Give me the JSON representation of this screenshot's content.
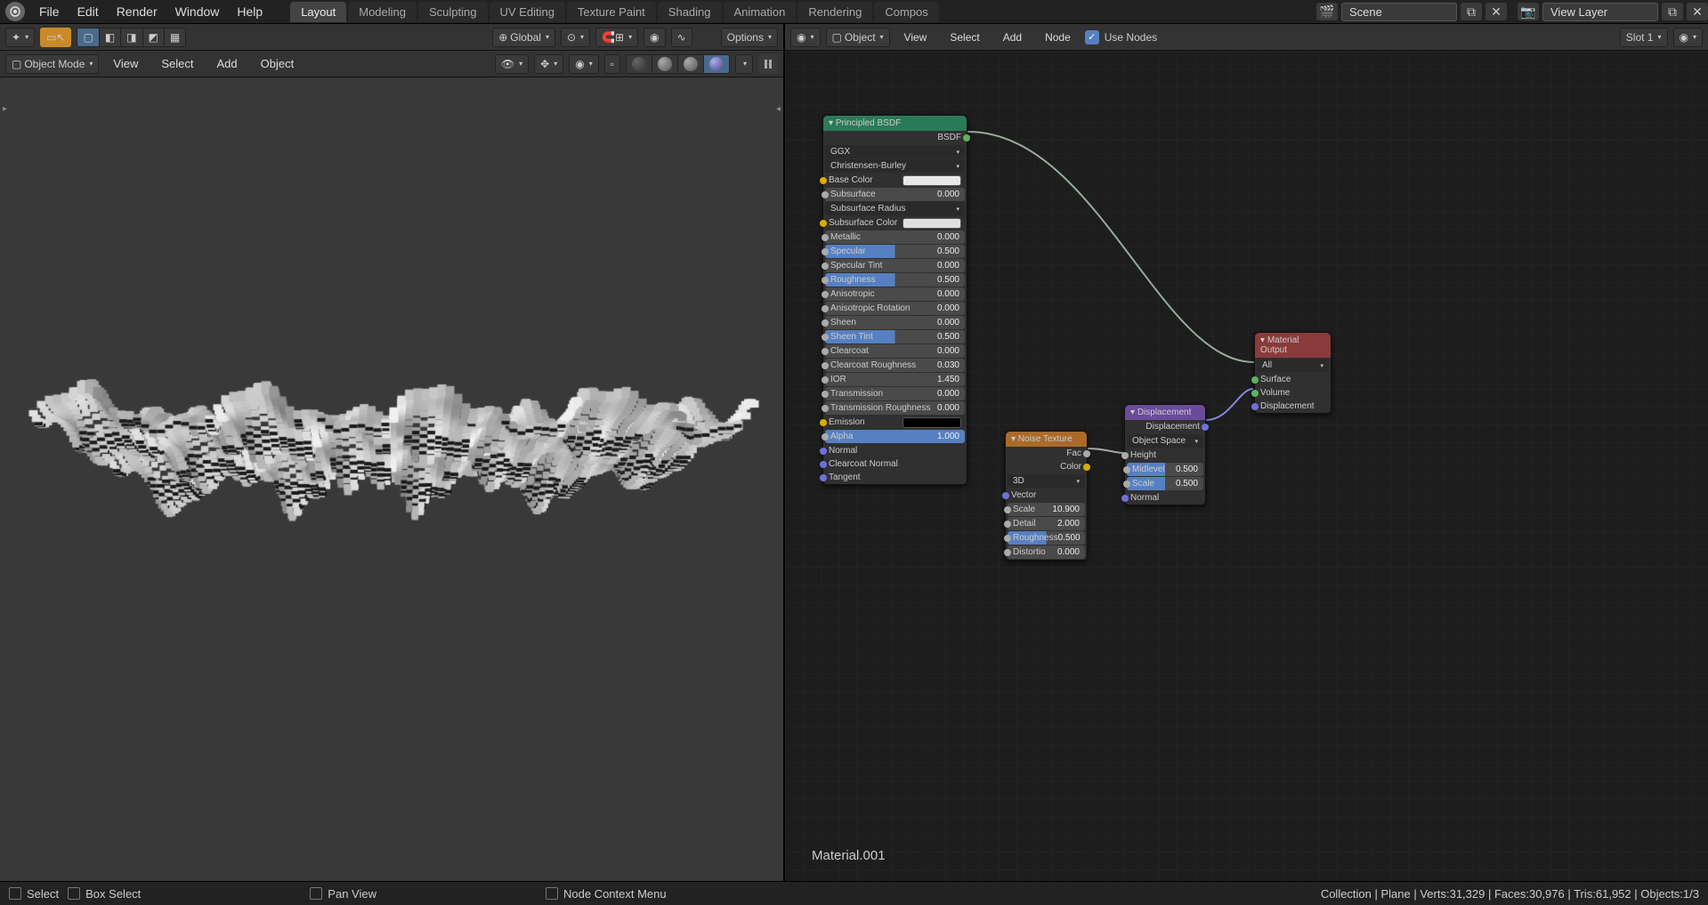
{
  "menu": {
    "items": [
      "File",
      "Edit",
      "Render",
      "Window",
      "Help"
    ]
  },
  "workspaces": {
    "items": [
      "Layout",
      "Modeling",
      "Sculpting",
      "UV Editing",
      "Texture Paint",
      "Shading",
      "Animation",
      "Rendering",
      "Compos"
    ],
    "active": 0
  },
  "scene": {
    "label": "Scene",
    "viewlayer": "View Layer"
  },
  "viewport": {
    "orientation": "Global",
    "mode": "Object Mode",
    "menus": [
      "View",
      "Select",
      "Add",
      "Object"
    ],
    "options": "Options"
  },
  "node_editor": {
    "mode": "Object",
    "menus": [
      "View",
      "Select",
      "Add",
      "Node"
    ],
    "use_nodes": "Use Nodes",
    "slot": "Slot 1",
    "material": "Material.001"
  },
  "nodes": {
    "bsdf": {
      "title": "Principled BSDF",
      "output": "BSDF",
      "distribution": "GGX",
      "sss_method": "Christensen-Burley",
      "props": [
        {
          "name": "Base Color",
          "type": "color",
          "value": "#e8e8e8"
        },
        {
          "name": "Subsurface",
          "type": "slider",
          "value": "0.000"
        },
        {
          "name": "Subsurface Radius",
          "type": "dropdown"
        },
        {
          "name": "Subsurface Color",
          "type": "color",
          "value": "#e0e0e0"
        },
        {
          "name": "Metallic",
          "type": "slider",
          "value": "0.000"
        },
        {
          "name": "Specular",
          "type": "sliderfill",
          "value": "0.500"
        },
        {
          "name": "Specular Tint",
          "type": "slider",
          "value": "0.000"
        },
        {
          "name": "Roughness",
          "type": "sliderfill",
          "value": "0.500"
        },
        {
          "name": "Anisotropic",
          "type": "slider",
          "value": "0.000"
        },
        {
          "name": "Anisotropic Rotation",
          "type": "slider",
          "value": "0.000"
        },
        {
          "name": "Sheen",
          "type": "slider",
          "value": "0.000"
        },
        {
          "name": "Sheen Tint",
          "type": "sliderfill",
          "value": "0.500"
        },
        {
          "name": "Clearcoat",
          "type": "slider",
          "value": "0.000"
        },
        {
          "name": "Clearcoat Roughness",
          "type": "slider",
          "value": "0.030"
        },
        {
          "name": "IOR",
          "type": "slider",
          "value": "1.450"
        },
        {
          "name": "Transmission",
          "type": "slider",
          "value": "0.000"
        },
        {
          "name": "Transmission Roughness",
          "type": "slider",
          "value": "0.000"
        },
        {
          "name": "Emission",
          "type": "color",
          "value": "#000000"
        },
        {
          "name": "Alpha",
          "type": "sliderfull",
          "value": "1.000"
        },
        {
          "name": "Normal",
          "type": "input"
        },
        {
          "name": "Clearcoat Normal",
          "type": "input"
        },
        {
          "name": "Tangent",
          "type": "input"
        }
      ]
    },
    "noise": {
      "title": "Noise Texture",
      "outputs": [
        "Fac",
        "Color"
      ],
      "dim": "3D",
      "vector": "Vector",
      "props": [
        {
          "name": "Scale",
          "value": "10.900"
        },
        {
          "name": "Detail",
          "value": "2.000"
        },
        {
          "name": "Roughness",
          "value": "0.500",
          "fill": true
        },
        {
          "name": "Distortio",
          "value": "0.000"
        }
      ]
    },
    "displacement": {
      "title": "Displacement",
      "output": "Displacement",
      "space": "Object Space",
      "height": "Height",
      "props": [
        {
          "name": "Midlevel",
          "value": "0.500"
        },
        {
          "name": "Scale",
          "value": "0.500"
        }
      ],
      "normal": "Normal"
    },
    "output": {
      "title": "Material Output",
      "target": "All",
      "inputs": [
        "Surface",
        "Volume",
        "Displacement"
      ]
    }
  },
  "statusbar": {
    "select": "Select",
    "box_select": "Box Select",
    "pan_view": "Pan View",
    "context_menu": "Node Context Menu",
    "stats": "Collection | Plane | Verts:31,329 | Faces:30,976 | Tris:61,952 | Objects:1/3"
  }
}
